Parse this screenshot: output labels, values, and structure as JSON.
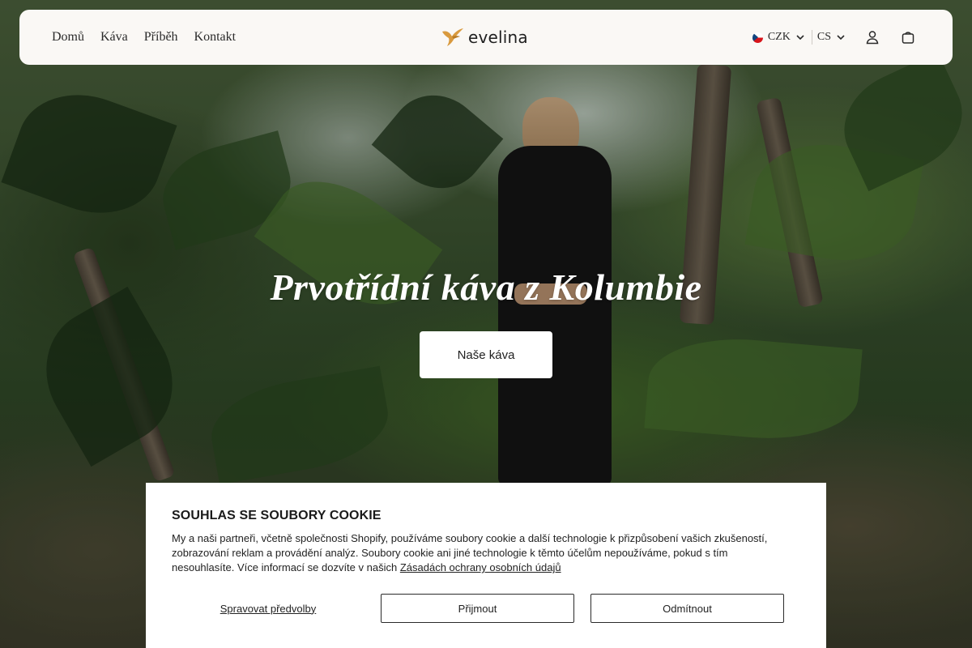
{
  "header": {
    "nav": [
      "Domů",
      "Káva",
      "Příběh",
      "Kontakt"
    ],
    "logo_text": "evelina",
    "currency": "CZK",
    "language": "CS",
    "icons": {
      "logo": "hummingbird-logo-icon",
      "flag": "czech-flag-icon",
      "chevron": "chevron-down-icon",
      "account": "user-icon",
      "cart": "shopping-bag-icon"
    }
  },
  "hero": {
    "title": "Prvotřídní káva z Kolumbie",
    "button_label": "Naše káva"
  },
  "cookie_banner": {
    "title": "SOUHLAS SE SOUBORY COOKIE",
    "text": "My a naši partneři, včetně společnosti Shopify, používáme soubory cookie a další technologie k přizpůsobení vašich zkušeností, zobrazování reklam a provádění analýz. Soubory cookie ani jiné technologie k těmto účelům nepoužíváme, pokud s tím nesouhlasíte. Více informací se dozvíte v našich",
    "policy_link": "Zásadách ochrany osobních údajů",
    "manage_label": "Spravovat předvolby",
    "accept_label": "Přijmout",
    "decline_label": "Odmítnout"
  },
  "colors": {
    "header_bg": "#faf8f5",
    "logo_accent": "#d99a3e",
    "text_dark": "#1f1f1f"
  }
}
